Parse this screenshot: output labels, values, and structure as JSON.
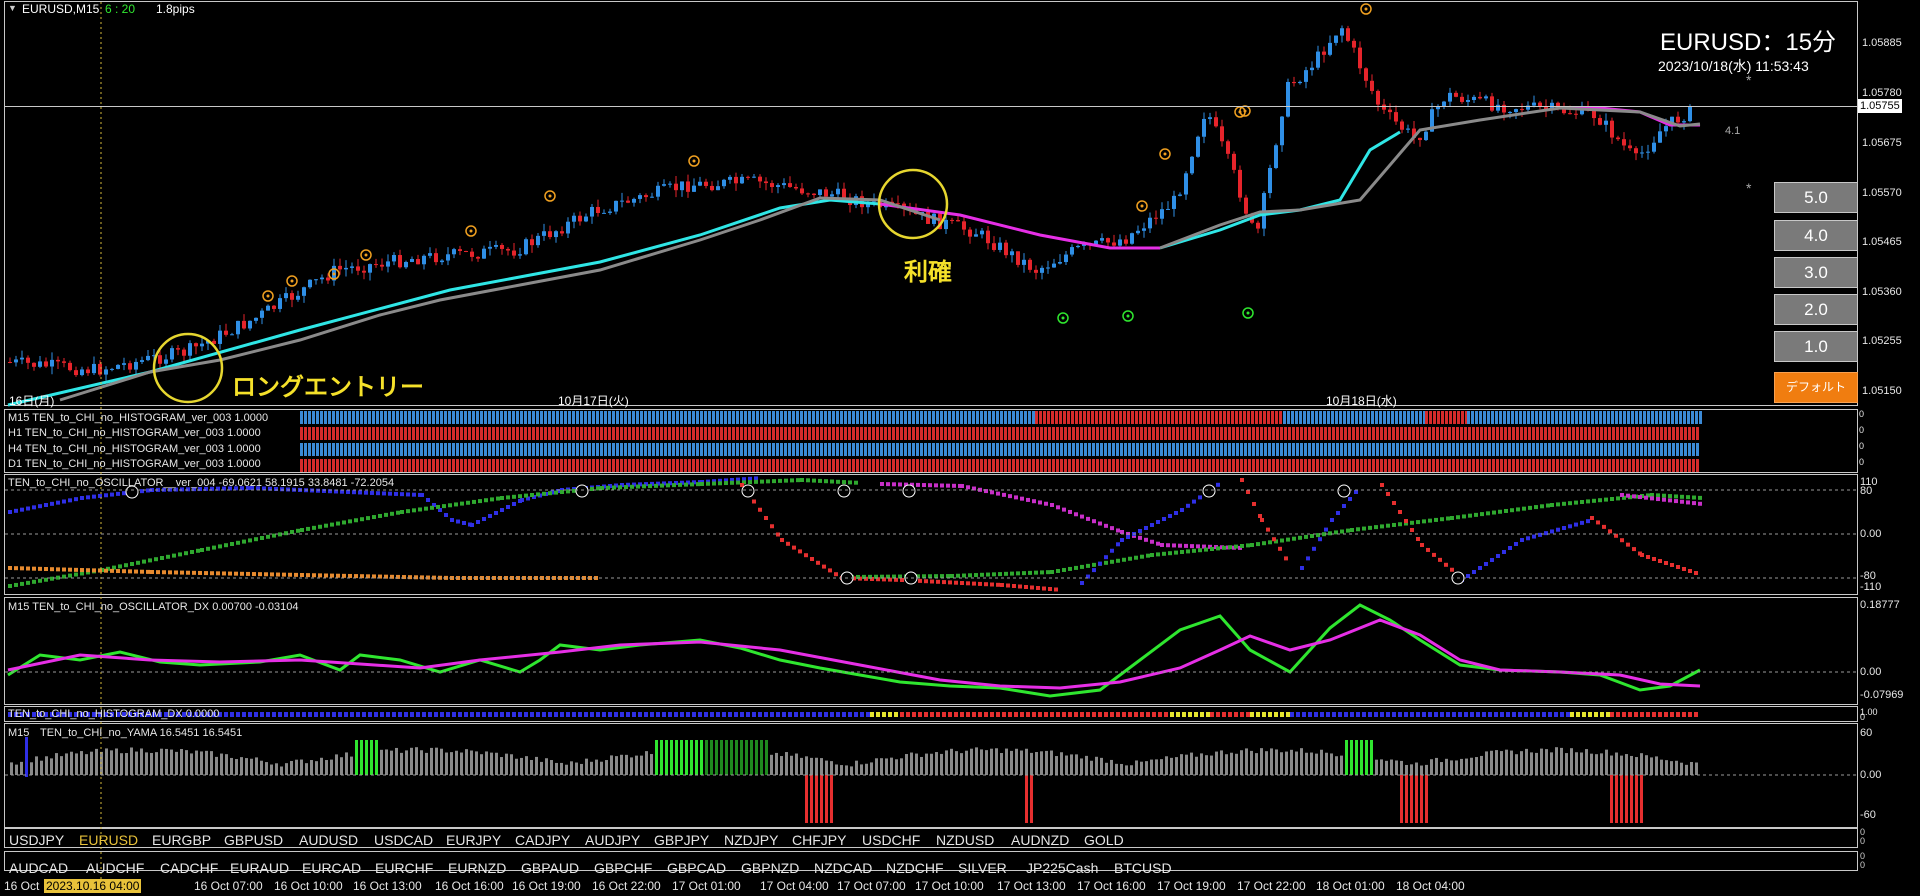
{
  "header": {
    "symbol_tf": "EURUSD,M15",
    "timer": "6 : 20",
    "spread": "1.8pips",
    "title": "EURUSD：15分",
    "datetime": "2023/10/18(水) 11:53:43",
    "side_value": "4.1"
  },
  "price_axis": [
    "1.05885",
    "1.05780",
    "1.05675",
    "1.05570",
    "1.05465",
    "1.05360",
    "1.05255",
    "1.05150"
  ],
  "current_price": "1.05755",
  "date_labels": [
    "16日(月)",
    "10月17日(火)",
    "10月18日(水)"
  ],
  "annotations": {
    "long_entry": "ロングエントリー",
    "take_profit": "利確"
  },
  "buttons": {
    "b5": "5.0",
    "b4": "4.0",
    "b3": "3.0",
    "b2": "2.0",
    "b1": "1.0",
    "default": "デフォルト"
  },
  "histogram_labels": [
    "M15 TEN_to_CHI_no_HISTOGRAM_ver_003 1.0000",
    "H1 TEN_to_CHI_no_HISTOGRAM_ver_003 1.0000",
    "H4 TEN_to_CHI_no_HISTOGRAM_ver_003 1.0000",
    "D1 TEN_to_CHI_no_HISTOGRAM_ver_003 1.0000"
  ],
  "histogram_axis": [
    "0",
    "0",
    "0",
    "0"
  ],
  "oscillator": {
    "label": "TEN_to_CHI_no_OSCILLATOR__ver_004 -69.0621 58.1915 33.8481 -72.2054",
    "axis": [
      "110",
      "80",
      "0.00",
      "-80",
      "-110"
    ]
  },
  "osc_dx": {
    "label": "M15 TEN_to_CHI_no_OSCILLATOR_DX 0.00700 -0.03104",
    "axis": [
      "0.18777",
      "0.00",
      "-0.07969"
    ]
  },
  "hist_dx": {
    "label": "TEN_to_CHI_no_HISTOGRAM_DX 0.0000",
    "axis": [
      "1.00",
      "0"
    ]
  },
  "yama": {
    "label_a": "M15",
    "label_b": "TEN_to_CHI_no_YAMA 16.5451 16.5451",
    "axis": [
      "60",
      "0.00",
      "-60"
    ]
  },
  "symbols_row1": [
    "USDJPY",
    "EURUSD",
    "EURGBP",
    "GBPUSD",
    "AUDUSD",
    "USDCAD",
    "EURJPY",
    "CADJPY",
    "AUDJPY",
    "GBPJPY",
    "NZDJPY",
    "CHFJPY",
    "USDCHF",
    "NZDUSD",
    "AUDNZD",
    "GOLD"
  ],
  "symbols_row2": [
    "AUDCAD",
    "AUDCHF",
    "CADCHF",
    "EURAUD",
    "EURCAD",
    "EURCHF",
    "EURNZD",
    "GBPAUD",
    "GBPCHF",
    "GBPCAD",
    "GBPNZD",
    "NZDCAD",
    "NZDCHF",
    "SILVER",
    "JP225Cash",
    "BTCUSD"
  ],
  "active_symbol": "EURUSD",
  "time_axis": [
    "16 Oct",
    "2023.10.16 04:00",
    "16 Oct 07:00",
    "16 Oct 10:00",
    "16 Oct 13:00",
    "16 Oct 16:00",
    "16 Oct 19:00",
    "16 Oct 22:00",
    "17 Oct 01:00",
    "17 Oct 04:00",
    "17 Oct 07:00",
    "17 Oct 10:00",
    "17 Oct 13:00",
    "17 Oct 16:00",
    "17 Oct 19:00",
    "17 Oct 22:00",
    "18 Oct 01:00",
    "18 Oct 04:00"
  ],
  "colors": {
    "bull": "#2f8fe6",
    "bear": "#e6242b",
    "ma_cyan": "#2fe6e6",
    "ma_magenta": "#e62fe6",
    "ma_gray": "#8a8a8a",
    "circle": "#e6d62f",
    "accent": "#f07d10"
  }
}
